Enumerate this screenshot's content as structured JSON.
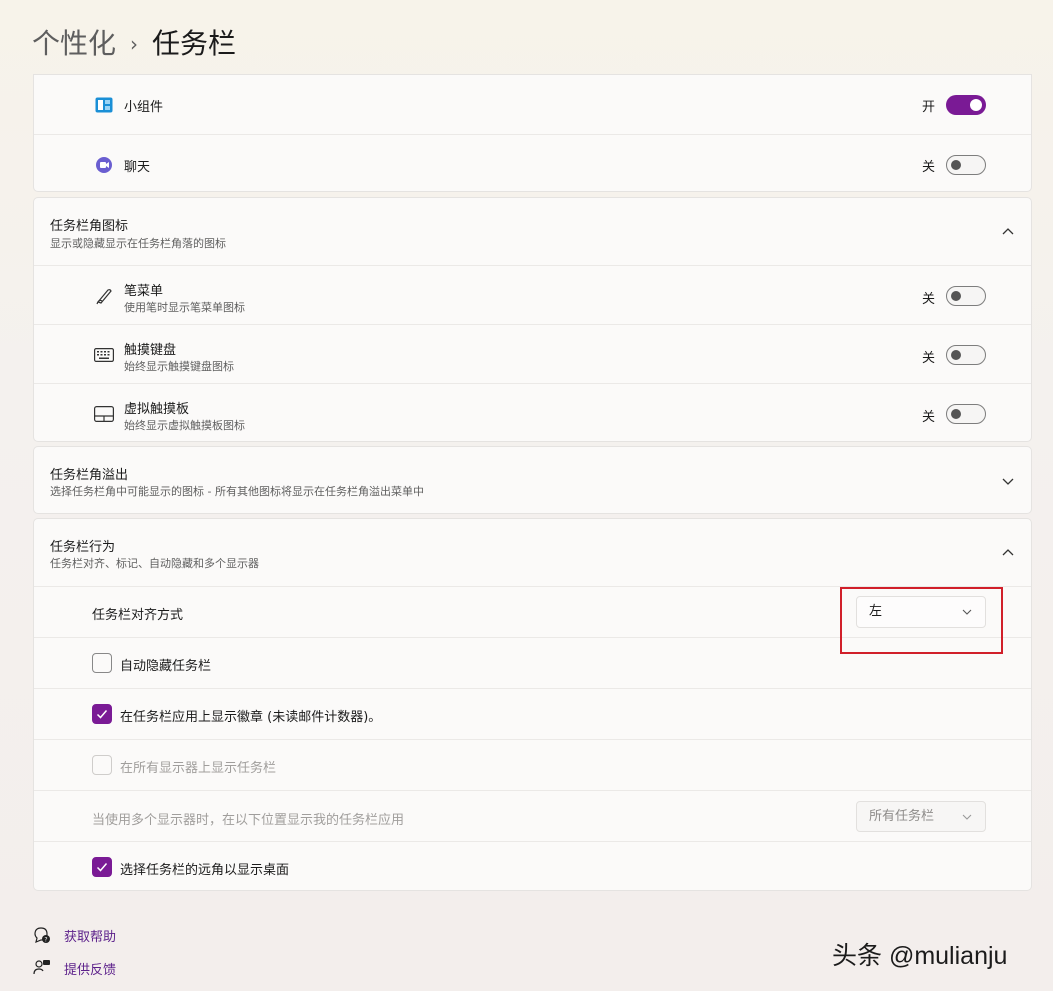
{
  "breadcrumb": {
    "parent": "个性化",
    "separator": "›",
    "current": "任务栏"
  },
  "taskbar_items": [
    {
      "label": "小组件",
      "state_label": "开",
      "on": true
    },
    {
      "label": "聊天",
      "state_label": "关",
      "on": false
    }
  ],
  "corner_icons": {
    "title": "任务栏角图标",
    "subtitle": "显示或隐藏显示在任务栏角落的图标",
    "expanded": true,
    "items": [
      {
        "title": "笔菜单",
        "subtitle": "使用笔时显示笔菜单图标",
        "state_label": "关",
        "on": false
      },
      {
        "title": "触摸键盘",
        "subtitle": "始终显示触摸键盘图标",
        "state_label": "关",
        "on": false
      },
      {
        "title": "虚拟触摸板",
        "subtitle": "始终显示虚拟触摸板图标",
        "state_label": "关",
        "on": false
      }
    ]
  },
  "corner_overflow": {
    "title": "任务栏角溢出",
    "subtitle": "选择任务栏角中可能显示的图标 - 所有其他图标将显示在任务栏角溢出菜单中",
    "expanded": false
  },
  "behavior": {
    "title": "任务栏行为",
    "subtitle": "任务栏对齐、标记、自动隐藏和多个显示器",
    "expanded": true,
    "alignment_label": "任务栏对齐方式",
    "alignment_value": "左",
    "auto_hide": {
      "label": "自动隐藏任务栏",
      "checked": false
    },
    "badges": {
      "label": "在任务栏应用上显示徽章 (未读邮件计数器)。",
      "checked": true
    },
    "all_displays": {
      "label": "在所有显示器上显示任务栏",
      "checked": false,
      "disabled": true
    },
    "multi_display_label": "当使用多个显示器时，在以下位置显示我的任务栏应用",
    "multi_display_value": "所有任务栏",
    "far_corner": {
      "label": "选择任务栏的远角以显示桌面",
      "checked": true
    }
  },
  "footer": {
    "help": "获取帮助",
    "feedback": "提供反馈"
  },
  "watermark": "头条 @mulianju",
  "colors": {
    "accent": "#7a1a95",
    "highlight": "#d11f2a"
  }
}
